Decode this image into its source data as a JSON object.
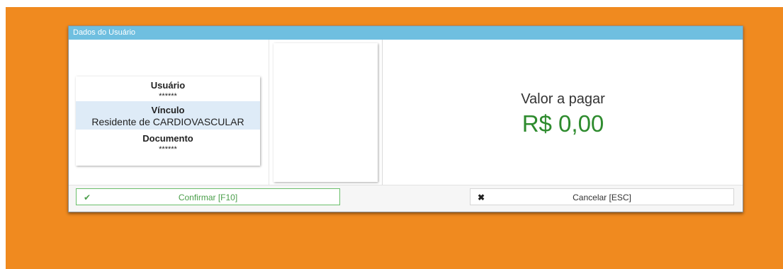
{
  "dialog": {
    "title": "Dados do Usuário"
  },
  "user_info": {
    "usuario_label": "Usuário",
    "usuario_value": "******",
    "vinculo_label": "Vínculo",
    "vinculo_value": "Residente de CARDIOVASCULAR",
    "documento_label": "Documento",
    "documento_value": "******"
  },
  "payment": {
    "label": "Valor a pagar",
    "amount": "R$ 0,00"
  },
  "footer": {
    "confirm_label": "Confirmar [F10]",
    "confirm_icon": "check-icon",
    "cancel_label": "Cancelar [ESC]",
    "cancel_icon": "close-icon"
  },
  "colors": {
    "background": "#f08a1f",
    "titlebar": "#6fbfe0",
    "amount": "#2e8b2e",
    "confirm": "#4a9e4a",
    "highlight_row": "#deebf7"
  }
}
